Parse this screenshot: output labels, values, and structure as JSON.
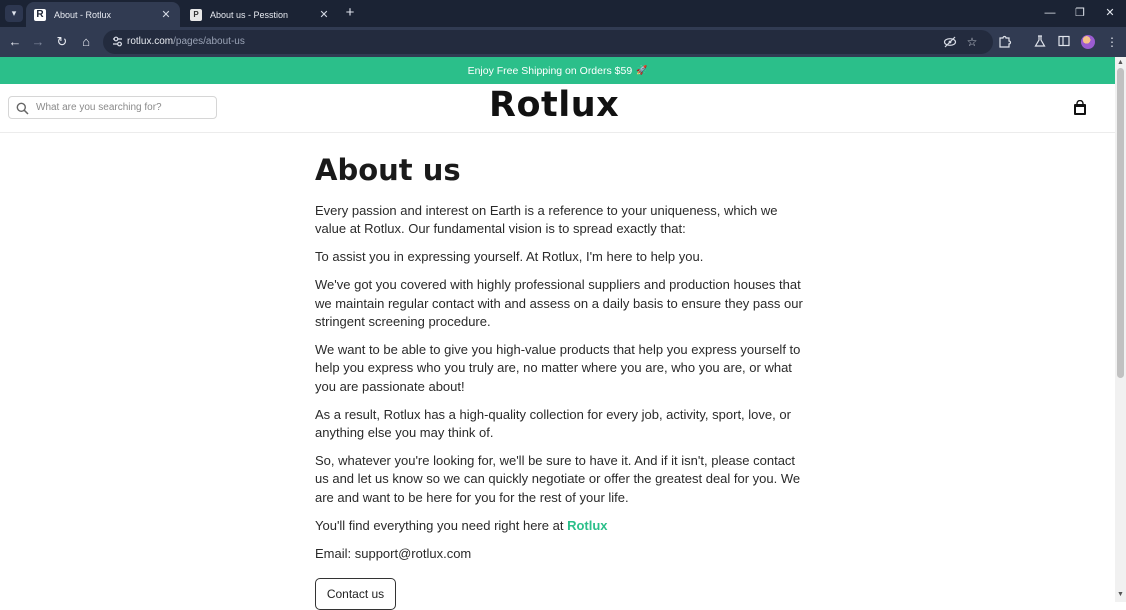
{
  "browser": {
    "tabs": [
      {
        "title": "About - Rotlux",
        "favicon": "R",
        "active": true
      },
      {
        "title": "About us - Pesstion",
        "favicon": "P",
        "active": false
      }
    ],
    "address": {
      "host": "rotlux.com",
      "path": "/pages/about-us"
    }
  },
  "announcement": {
    "text": "Enjoy Free Shipping on Orders $59",
    "deco": "🚀"
  },
  "header": {
    "search_placeholder": "What are you searching for?",
    "logo": "Rotlux"
  },
  "page": {
    "title": "About us",
    "paragraphs": [
      "Every passion and interest on Earth is a reference to your uniqueness, which we value at Rotlux. Our fundamental vision is to spread exactly that:",
      "To assist you in expressing yourself. At Rotlux, I'm here to help you.",
      "We've got you covered with highly professional suppliers and production houses that we maintain regular contact with and assess on a daily basis to ensure they pass our stringent screening procedure.",
      "We want to be able to give you high-value products that help you express yourself to help you express who you truly are, no matter where you are, who you are, or what you are passionate about!",
      "As a result, Rotlux has a high-quality collection for every job, activity, sport, love, or anything else you may think of.",
      " So, whatever you're looking for, we'll be sure to have it. And if it isn't, please contact us and let us know so we can quickly negotiate or offer the greatest deal for you. We are and want to be here for you for the rest of your life."
    ],
    "find_text": "You'll find everything you need right here at ",
    "find_link": "Rotlux",
    "email": "Email: support@rotlux.com",
    "contact_button": "Contact us"
  },
  "colors": {
    "accent": "#2bbf8a",
    "chrome_dark": "#1b2334",
    "chrome_mid": "#313b52"
  }
}
